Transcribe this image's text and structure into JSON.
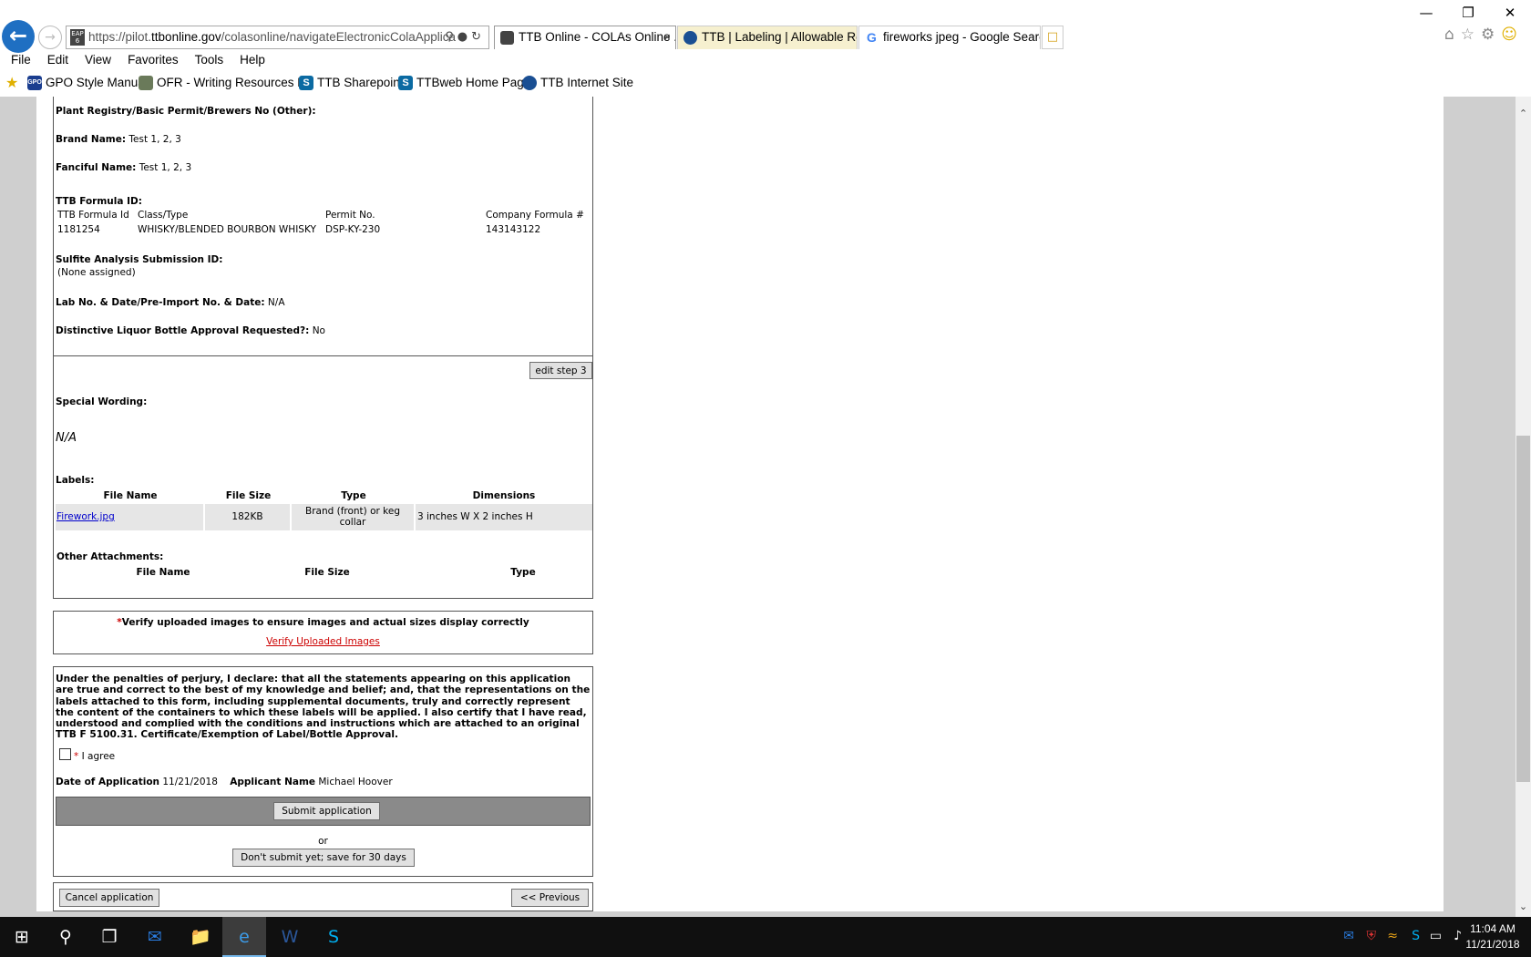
{
  "browser": {
    "url_prefix": "https://pilot.",
    "url_domain": "ttbonline.gov",
    "url_path": "/colasonline/navigateElectronicColaApplica",
    "site_icon_text": "EAP 6",
    "tabs": [
      {
        "title": "TTB Online - COLAs Online ...",
        "close": "×"
      },
      {
        "title": "TTB | Labeling | Allowable Revi..."
      },
      {
        "title": "fireworks jpeg - Google Search",
        "icon_text": "G"
      }
    ],
    "menu": [
      "File",
      "Edit",
      "View",
      "Favorites",
      "Tools",
      "Help"
    ],
    "favorites": [
      {
        "label": "GPO Style Manual",
        "icon_text": "GPO"
      },
      {
        "label": "OFR - Writing Resources F..."
      },
      {
        "label": "TTB Sharepoint",
        "icon_text": "S"
      },
      {
        "label": "TTBweb Home Page",
        "icon_text": "S"
      },
      {
        "label": "TTB Internet Site"
      }
    ],
    "window_controls": [
      "—",
      "❐",
      "✕"
    ]
  },
  "step2": {
    "plant_registry_label": "Plant Registry/Basic Permit/Brewers No (Other):",
    "brand_name_label": "Brand Name:",
    "brand_name_value": "Test 1, 2, 3",
    "fanciful_name_label": "Fanciful Name:",
    "fanciful_name_value": "Test 1, 2, 3",
    "formula_id_label": "TTB Formula ID:",
    "formula_headers": [
      "TTB Formula Id",
      "Class/Type",
      "Permit No.",
      "Company Formula #"
    ],
    "formula_row": [
      "1181254",
      "WHISKY/BLENDED BOURBON WHISKY",
      "DSP-KY-230",
      "143143122"
    ],
    "sulfite_label": "Sulfite Analysis Submission ID:",
    "sulfite_value": "(None assigned)",
    "lab_label": "Lab No. & Date/Pre-Import No. & Date:",
    "lab_value": "N/A",
    "bottle_label": "Distinctive Liquor Bottle Approval Requested?:",
    "bottle_value": "No"
  },
  "step3": {
    "edit_button": "edit step 3",
    "special_wording_label": "Special Wording:",
    "special_wording_value": "N/A",
    "labels_label": "Labels:",
    "label_headers": [
      "File Name",
      "File Size",
      "Type",
      "Dimensions"
    ],
    "label_rows": [
      {
        "file": "Firework.jpg",
        "size": "182KB",
        "type": "Brand (front) or keg collar",
        "dimensions": "3 inches W X 2 inches H"
      }
    ],
    "other_label": "Other Attachments:",
    "other_headers": [
      "File Name",
      "File Size",
      "Type"
    ]
  },
  "verify": {
    "asterisk": "*",
    "message": "Verify uploaded images to ensure images and actual sizes display correctly",
    "link": "Verify Uploaded Images"
  },
  "declaration": {
    "text": "Under the penalties of perjury, I declare: that all the statements appearing on this application are true and correct to the best of my knowledge and belief; and, that the representations on the labels attached to this form, including supplemental documents, truly and correctly represent the content of the containers to which these labels will be applied. I also certify that I have read, understood and complied with the conditions and instructions which are attached to an original TTB F 5100.31. Certificate/Exemption of Label/Bottle Approval.",
    "agree_asterisk": "*",
    "agree_label": "I agree",
    "date_label": "Date of Application",
    "date_value": "11/21/2018",
    "applicant_label": "Applicant Name",
    "applicant_value": "Michael  Hoover",
    "submit_button": "Submit application",
    "or_text": "or",
    "save_button": "Don't submit yet; save for 30 days"
  },
  "footer_nav": {
    "cancel_button": "Cancel application",
    "previous_button": "<< Previous"
  },
  "taskbar": {
    "time": "11:04 AM",
    "date": "11/21/2018"
  },
  "colors": {
    "accent_blue": "#1f6fc2",
    "link_red": "#cc0000",
    "submit_bar": "#8a8a8a",
    "page_gutter": "#cfcfcf"
  }
}
